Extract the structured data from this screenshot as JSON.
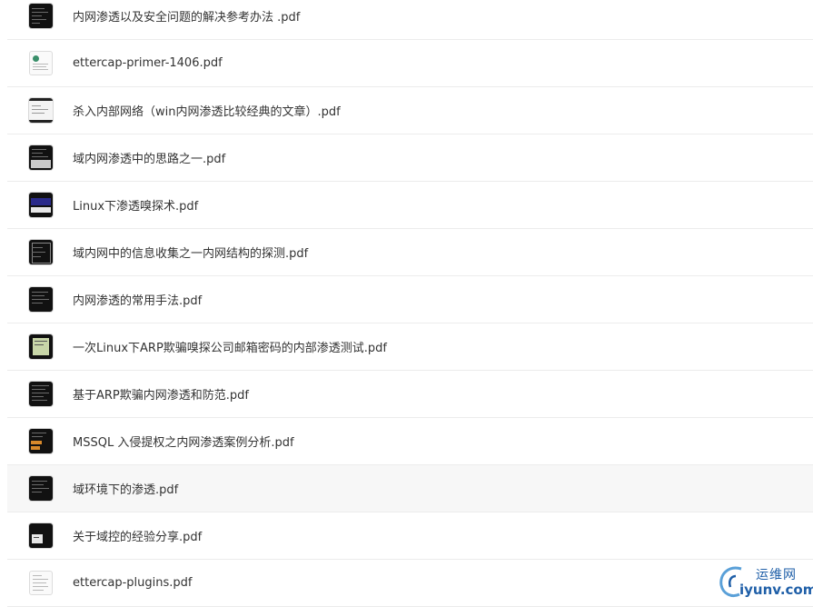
{
  "files": [
    {
      "name": "内网渗透以及安全问题的解决参考办法 .pdf",
      "thumb": "dark"
    },
    {
      "name": "ettercap-primer-1406.pdf",
      "thumb": "document"
    },
    {
      "name": "杀入内部网络（win内网渗透比较经典的文章）.pdf",
      "thumb": "screenshot"
    },
    {
      "name": "域内网渗透中的思路之一.pdf",
      "thumb": "dark"
    },
    {
      "name": "Linux下渗透嗅探术.pdf",
      "thumb": "dark-blue"
    },
    {
      "name": "域内网中的信息收集之一内网结构的探测.pdf",
      "thumb": "dark"
    },
    {
      "name": "内网渗透的常用手法.pdf",
      "thumb": "dark"
    },
    {
      "name": "一次Linux下ARP欺骗嗅探公司邮箱密码的内部渗透测试.pdf",
      "thumb": "green"
    },
    {
      "name": "基于ARP欺骗内网渗透和防范.pdf",
      "thumb": "dark"
    },
    {
      "name": "MSSQL 入侵提权之内网渗透案例分析.pdf",
      "thumb": "dark-orange"
    },
    {
      "name": "域环境下的渗透.pdf",
      "thumb": "dark"
    },
    {
      "name": "关于域控的经验分享.pdf",
      "thumb": "dark-window"
    },
    {
      "name": "ettercap-plugins.pdf",
      "thumb": "document"
    }
  ],
  "watermark": {
    "cn": "运维网",
    "en": "iyunv.com"
  }
}
